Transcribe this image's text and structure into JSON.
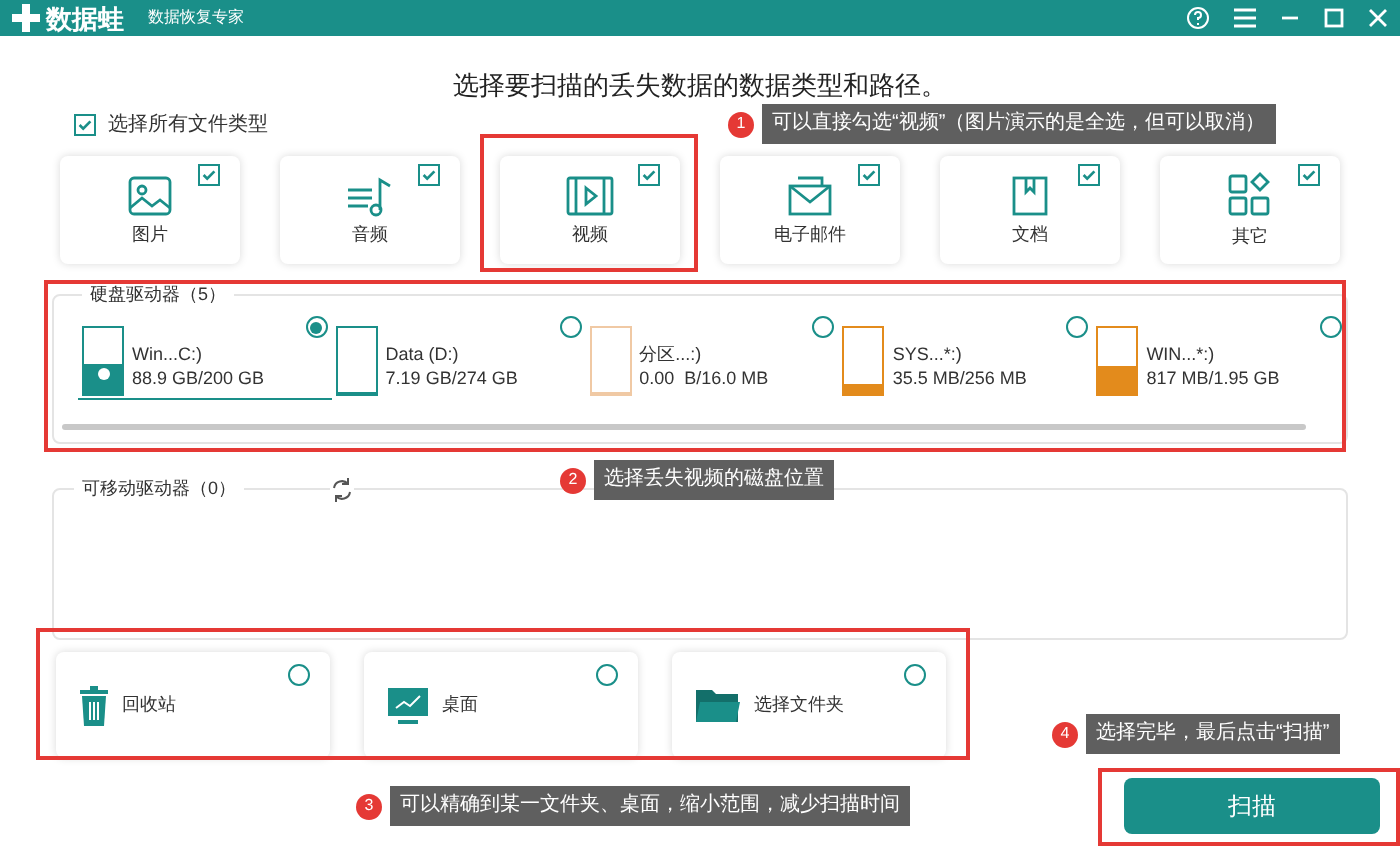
{
  "app": {
    "logo_text": "数据蛙",
    "subtitle": "数据恢复专家"
  },
  "heading": "选择要扫描的丢失数据的数据类型和路径。",
  "select_all": {
    "label": "选择所有文件类型",
    "checked": true
  },
  "file_types": [
    {
      "kind": "image",
      "label": "图片",
      "checked": true
    },
    {
      "kind": "audio",
      "label": "音频",
      "checked": true
    },
    {
      "kind": "video",
      "label": "视频",
      "checked": true
    },
    {
      "kind": "email",
      "label": "电子邮件",
      "checked": true
    },
    {
      "kind": "document",
      "label": "文档",
      "checked": true
    },
    {
      "kind": "other",
      "label": "其它",
      "checked": true
    }
  ],
  "hard_drives": {
    "title": "硬盘驱动器（5）",
    "drives": [
      {
        "name": "Win...C:)",
        "usage": "88.9 GB/200 GB",
        "level": 0.45,
        "color": "#1a8f89",
        "system": true,
        "selected": true
      },
      {
        "name": "Data (D:)",
        "usage": "7.19 GB/274 GB",
        "level": 0.03,
        "color": "#1a8f89",
        "system": false,
        "selected": false
      },
      {
        "name": "分区...:)",
        "usage": "0.00  B/16.0 MB",
        "level": 0,
        "color": "#f0c9a4",
        "system": false,
        "selected": false
      },
      {
        "name": "SYS...*:)",
        "usage": "35.5 MB/256 MB",
        "level": 0.14,
        "color": "#e38b1c",
        "system": false,
        "selected": false
      },
      {
        "name": "WIN...*:)",
        "usage": "817 MB/1.95 GB",
        "level": 0.42,
        "color": "#e38b1c",
        "system": false,
        "selected": false
      }
    ]
  },
  "removable": {
    "title": "可移动驱动器（0）"
  },
  "locations": [
    {
      "kind": "recycle",
      "label": "回收站",
      "selected": false
    },
    {
      "kind": "desktop",
      "label": "桌面",
      "selected": false
    },
    {
      "kind": "folder",
      "label": "选择文件夹",
      "selected": false
    }
  ],
  "scan_button": "扫描",
  "annotations": [
    {
      "number": "1",
      "text": "可以直接勾选“视频”（图片演示的是全选，但可以取消）"
    },
    {
      "number": "2",
      "text": "选择丢失视频的磁盘位置"
    },
    {
      "number": "3",
      "text": "可以精确到某一文件夹、桌面，缩小范围，减少扫描时间"
    },
    {
      "number": "4",
      "text": "选择完毕，最后点击“扫描”"
    }
  ]
}
